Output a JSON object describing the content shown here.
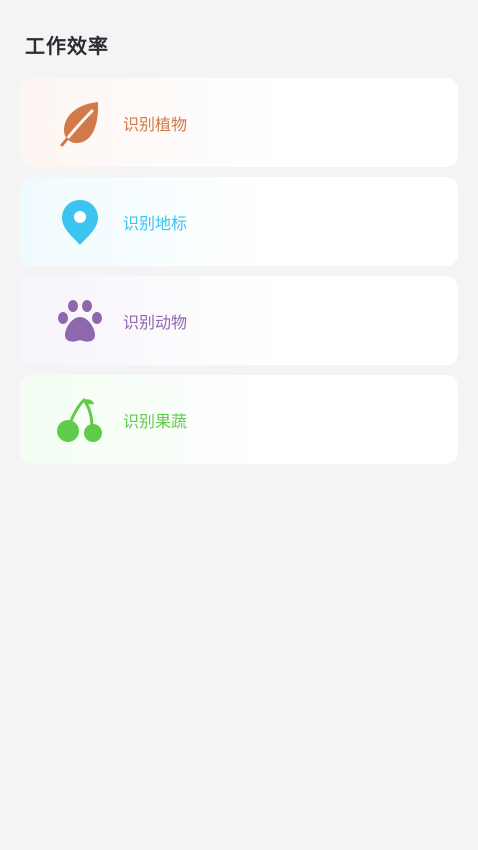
{
  "section": {
    "title": "工作效率"
  },
  "items": [
    {
      "label": "识别植物",
      "icon": "leaf-icon",
      "color": "#d07a4c"
    },
    {
      "label": "识别地标",
      "icon": "location-pin-icon",
      "color": "#3cc3ee"
    },
    {
      "label": "识别动物",
      "icon": "paw-icon",
      "color": "#8e67ad"
    },
    {
      "label": "识别果蔬",
      "icon": "cherry-icon",
      "color": "#5fcb4a"
    }
  ]
}
